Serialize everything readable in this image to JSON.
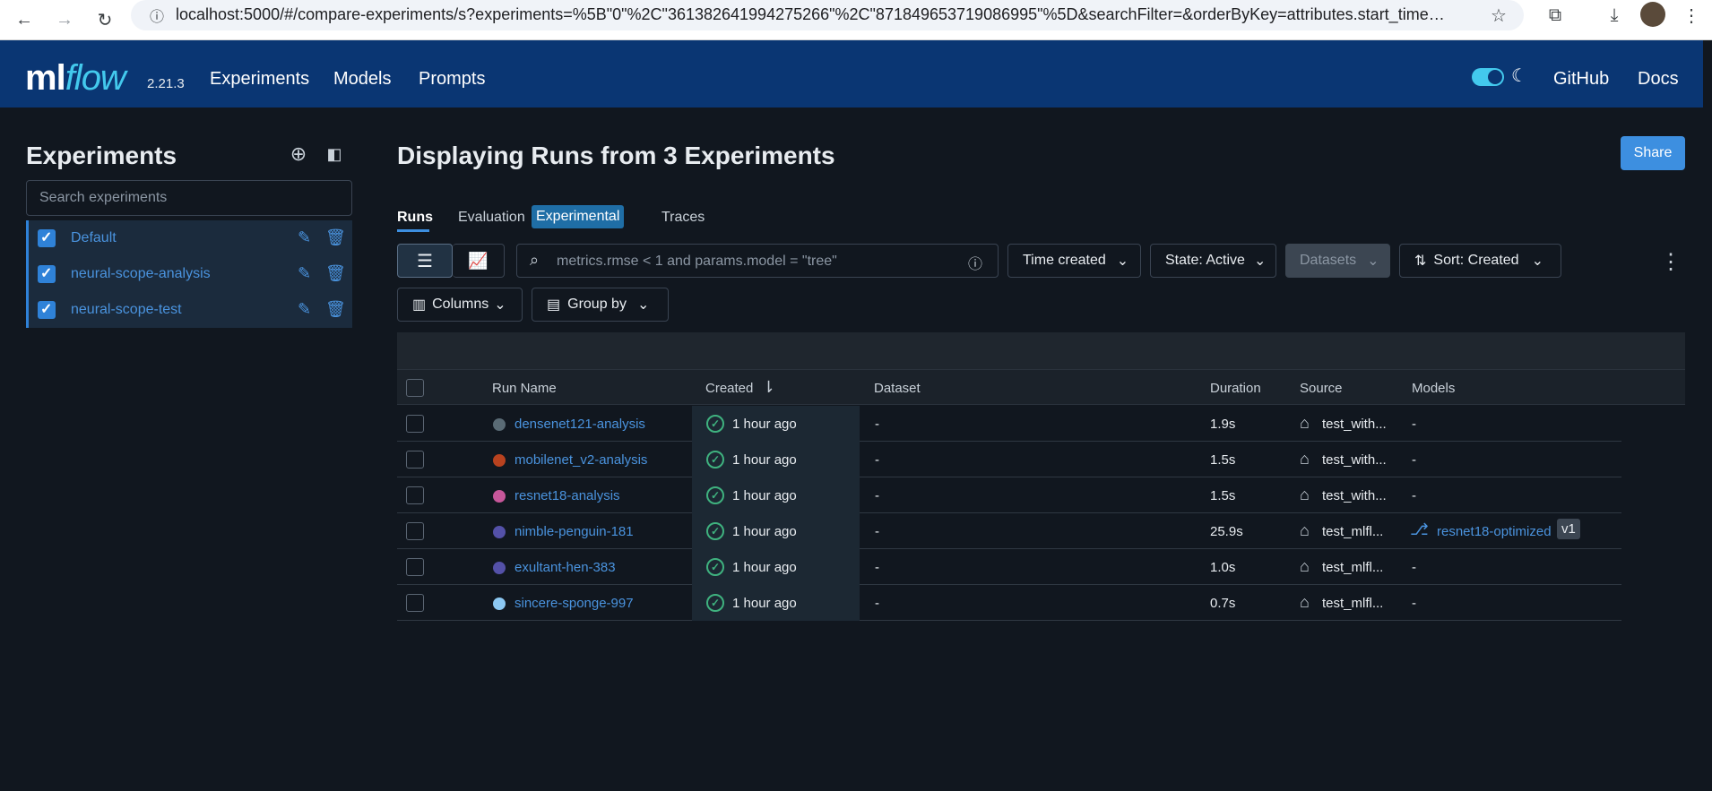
{
  "browser": {
    "url": "localhost:5000/#/compare-experiments/s?experiments=%5B\"0\"%2C\"361382641994275266\"%2C\"871849653719086995\"%5D&searchFilter=&orderByKey=attributes.start_time&orderByAs..."
  },
  "header": {
    "logo_text": "ml",
    "logo_flow": "flow",
    "version": "2.21.3",
    "nav": [
      "Experiments",
      "Models",
      "Prompts"
    ],
    "right_links": [
      "GitHub",
      "Docs"
    ]
  },
  "sidebar": {
    "title": "Experiments",
    "search_placeholder": "Search experiments",
    "experiments": [
      {
        "name": "Default",
        "checked": true
      },
      {
        "name": "neural-scope-analysis",
        "checked": true
      },
      {
        "name": "neural-scope-test",
        "checked": true
      }
    ]
  },
  "main": {
    "title": "Displaying Runs from 3 Experiments",
    "share_label": "Share",
    "tabs": [
      "Runs",
      "Evaluation",
      "Traces"
    ],
    "experimental_badge": "Experimental",
    "filter_placeholder": "metrics.rmse < 1 and params.model = \"tree\"",
    "time_created": "Time created",
    "state": "State: Active",
    "datasets": "Datasets",
    "sort": "Sort: Created",
    "columns": "Columns",
    "group_by": "Group by"
  },
  "table": {
    "headers": {
      "run_name": "Run Name",
      "created": "Created",
      "dataset": "Dataset",
      "duration": "Duration",
      "source": "Source",
      "models": "Models"
    },
    "rows": [
      {
        "name": "densenet121-analysis",
        "color": "#5a6b75",
        "created": "1 hour ago",
        "dataset": "-",
        "duration": "1.9s",
        "source": "test_with...",
        "model": "-",
        "model_version": ""
      },
      {
        "name": "mobilenet_v2-analysis",
        "color": "#b8421f",
        "created": "1 hour ago",
        "dataset": "-",
        "duration": "1.5s",
        "source": "test_with...",
        "model": "-",
        "model_version": ""
      },
      {
        "name": "resnet18-analysis",
        "color": "#c7579a",
        "created": "1 hour ago",
        "dataset": "-",
        "duration": "1.5s",
        "source": "test_with...",
        "model": "-",
        "model_version": ""
      },
      {
        "name": "nimble-penguin-181",
        "color": "#5451a8",
        "created": "1 hour ago",
        "dataset": "-",
        "duration": "25.9s",
        "source": "test_mlfl...",
        "model": "resnet18-optimized",
        "model_version": "v1"
      },
      {
        "name": "exultant-hen-383",
        "color": "#5451a8",
        "created": "1 hour ago",
        "dataset": "-",
        "duration": "1.0s",
        "source": "test_mlfl...",
        "model": "-",
        "model_version": ""
      },
      {
        "name": "sincere-sponge-997",
        "color": "#8cc8f2",
        "created": "1 hour ago",
        "dataset": "-",
        "duration": "0.7s",
        "source": "test_mlfl...",
        "model": "-",
        "model_version": ""
      }
    ]
  }
}
